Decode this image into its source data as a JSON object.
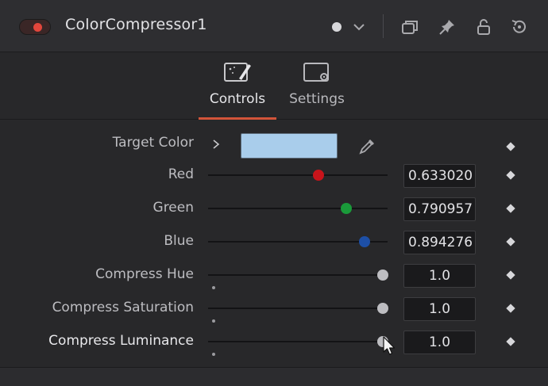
{
  "header": {
    "title": "ColorCompressor1",
    "toggle_color": "#e2463c",
    "icons": [
      "toggle-switch-icon",
      "dot-icon",
      "chevron-down-icon",
      "window-icon",
      "pin-icon",
      "lock-icon",
      "reset-icon"
    ]
  },
  "tabs": [
    {
      "label": "Controls",
      "icon": "controls-tab-icon",
      "active": true
    },
    {
      "label": "Settings",
      "icon": "settings-tab-icon",
      "active": false
    }
  ],
  "controls": {
    "target_color": {
      "label": "Target Color",
      "swatch_color": "#a9cdeb"
    },
    "red": {
      "label": "Red",
      "value": "0.633020",
      "fraction": 0.63302,
      "knob_color": "#c8141b"
    },
    "green": {
      "label": "Green",
      "value": "0.790957",
      "fraction": 0.790957,
      "knob_color": "#1a9a3a"
    },
    "blue": {
      "label": "Blue",
      "value": "0.894276",
      "fraction": 0.894276,
      "knob_color": "#1d4fa6"
    },
    "compress_hue": {
      "label": "Compress Hue",
      "value": "1.0",
      "fraction": 1.0
    },
    "compress_saturation": {
      "label": "Compress Saturation",
      "value": "1.0",
      "fraction": 1.0
    },
    "compress_luminance": {
      "label": "Compress Luminance",
      "value": "1.0",
      "fraction": 1.0
    }
  },
  "colors": {
    "accent": "#d2543a",
    "panel_bg": "#28282a",
    "neutral_knob": "#bdbdc1"
  }
}
